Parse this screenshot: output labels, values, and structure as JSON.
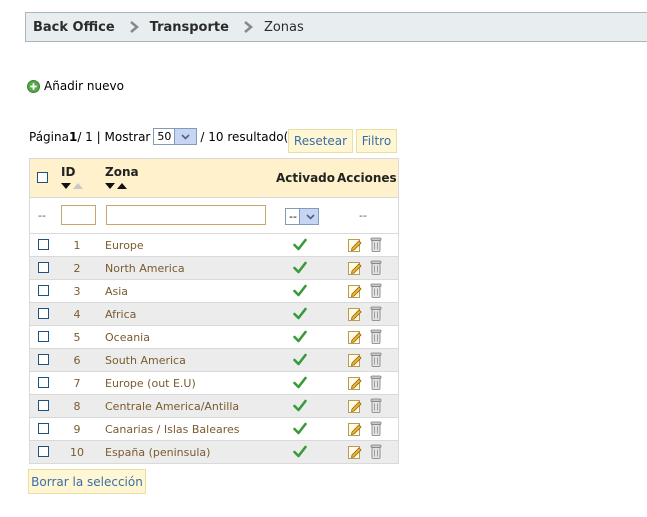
{
  "breadcrumb": {
    "items": [
      "Back Office",
      "Transporte",
      "Zonas"
    ]
  },
  "actions": {
    "add_new": "Añadir nuevo",
    "reset": "Resetear",
    "filter": "Filtro",
    "delete_selection": "Borrar la selección"
  },
  "pager": {
    "page_label": "Página ",
    "page_current": "1",
    "page_total_text": " / 1 | Mostrar",
    "per_page": "50",
    "results_text": "/ 10 resultado(s)"
  },
  "table": {
    "columns": {
      "id": "ID",
      "zone": "Zona",
      "active": "Activado",
      "actions": "Acciones"
    },
    "filter": {
      "dash": "--",
      "active_select": "--",
      "actions_dash": "--"
    },
    "rows": [
      {
        "id": "1",
        "zone": "Europe"
      },
      {
        "id": "2",
        "zone": "North America"
      },
      {
        "id": "3",
        "zone": "Asia"
      },
      {
        "id": "4",
        "zone": "Africa"
      },
      {
        "id": "5",
        "zone": "Oceania"
      },
      {
        "id": "6",
        "zone": "South America"
      },
      {
        "id": "7",
        "zone": "Europe (out E.U)"
      },
      {
        "id": "8",
        "zone": "Centrale America/Antilla"
      },
      {
        "id": "9",
        "zone": "Canarias / Islas Baleares"
      },
      {
        "id": "10",
        "zone": "España (peninsula)"
      }
    ]
  },
  "icons": {
    "separator": "chevron-right-icon",
    "add": "plus-circle-icon",
    "active": "checkmark-icon",
    "edit": "pencil-icon",
    "delete": "trash-icon"
  },
  "colors": {
    "header_bg": "#fff1cc",
    "button_bg": "#fff6d3",
    "button_text": "#3a6fa6",
    "zone_text": "#7a5b2e",
    "check_green": "#3a9a3a"
  }
}
